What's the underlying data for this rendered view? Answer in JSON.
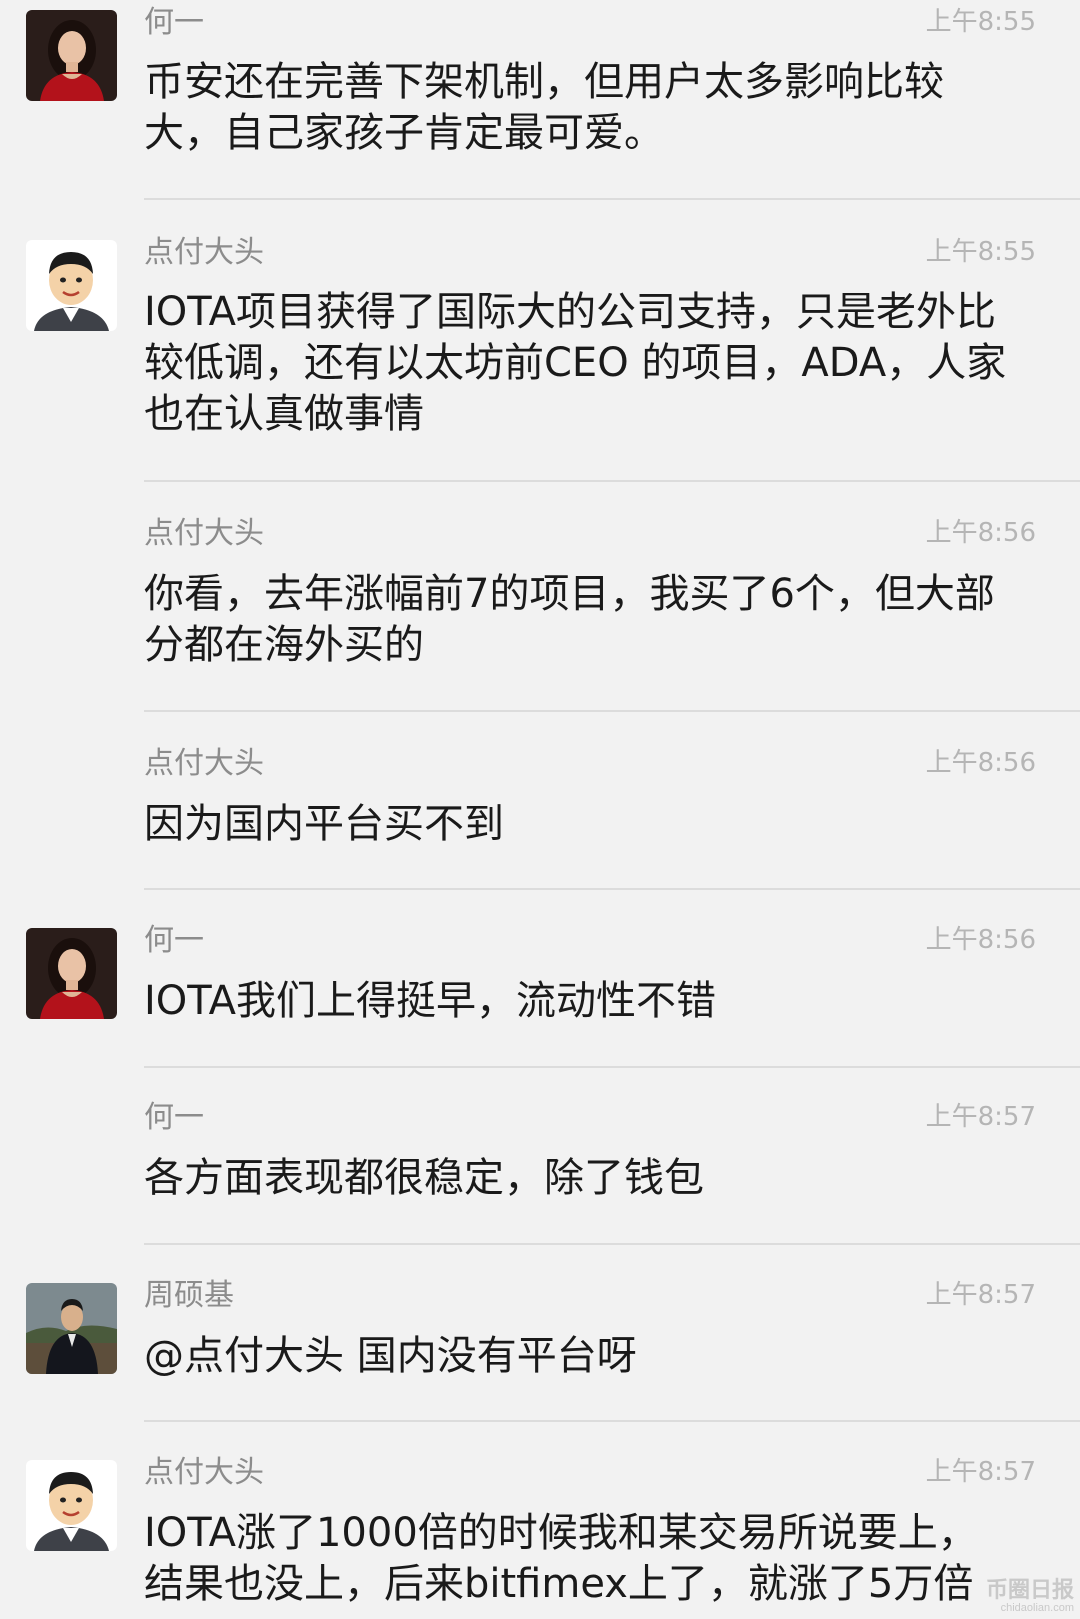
{
  "messages": [
    {
      "sender": "何一",
      "time": "上午8:55",
      "text": "币安还在完善下架机制，但用户太多影响比较大，自己家孩子肯定最可爱。",
      "avatar": "avatar-woman"
    },
    {
      "sender": "点付大头",
      "time": "上午8:55",
      "text": "IOTA项目获得了国际大的公司支持，只是老外比较低调，还有以太坊前CEO 的项目，ADA，人家也在认真做事情",
      "avatar": "avatar-cartoon-man"
    },
    {
      "sender": "点付大头",
      "time": "上午8:56",
      "text": "你看，去年涨幅前7的项目，我买了6个，但大部分都在海外买的",
      "avatar": ""
    },
    {
      "sender": "点付大头",
      "time": "上午8:56",
      "text": "因为国内平台买不到",
      "avatar": ""
    },
    {
      "sender": "何一",
      "time": "上午8:56",
      "text": "IOTA我们上得挺早，流动性不错",
      "avatar": "avatar-woman"
    },
    {
      "sender": "何一",
      "time": "上午8:57",
      "text": "各方面表现都很稳定，除了钱包",
      "avatar": ""
    },
    {
      "sender": "周硕基",
      "time": "上午8:57",
      "text": "@点付大头 国内没有平台呀",
      "avatar": "avatar-man-photo"
    },
    {
      "sender": "点付大头",
      "time": "上午8:57",
      "text": "IOTA涨了1000倍的时候我和某交易所说要上，结果也没上，后来bitfimex上了，就涨了5万倍",
      "avatar": "avatar-cartoon-man"
    }
  ],
  "watermark": {
    "main": "币圈日报",
    "sub": "chidaolian.com"
  }
}
